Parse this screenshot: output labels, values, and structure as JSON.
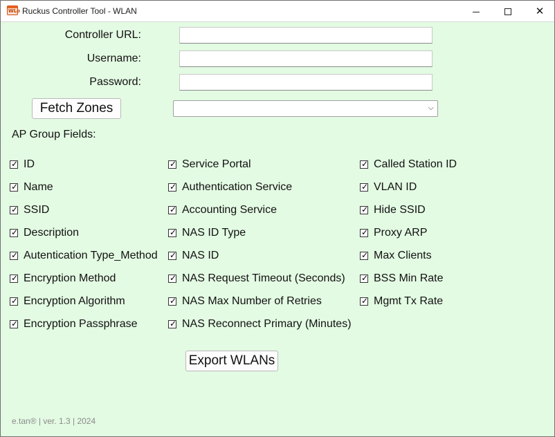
{
  "window": {
    "title": "Ruckus Controller Tool - WLAN",
    "app_icon_glyph": "WLo",
    "minimize_glyph": "",
    "close_glyph": "✕"
  },
  "form": {
    "controller_url_label": "Controller URL:",
    "controller_url_value": "",
    "username_label": "Username:",
    "username_value": "",
    "password_label": "Password:",
    "password_value": "",
    "fetch_zones_label": "Fetch Zones",
    "zone_selected": "",
    "zone_chevron": "⌵"
  },
  "ap_group_fields_label": "AP Group Fields:",
  "checkbox_mark": "✓",
  "fields": {
    "col1": [
      {
        "label": "ID",
        "checked": true
      },
      {
        "label": "Name",
        "checked": true
      },
      {
        "label": "SSID",
        "checked": true
      },
      {
        "label": "Description",
        "checked": true
      },
      {
        "label": "Autentication Type_Method",
        "checked": true
      },
      {
        "label": "Encryption Method",
        "checked": true
      },
      {
        "label": "Encryption Algorithm",
        "checked": true
      },
      {
        "label": "Encryption Passphrase",
        "checked": true
      }
    ],
    "col2": [
      {
        "label": "Service Portal",
        "checked": true
      },
      {
        "label": "Authentication Service",
        "checked": true
      },
      {
        "label": "Accounting Service",
        "checked": true
      },
      {
        "label": "NAS ID Type",
        "checked": true
      },
      {
        "label": "NAS ID",
        "checked": true
      },
      {
        "label": "NAS Request Timeout (Seconds)",
        "checked": true
      },
      {
        "label": "NAS Max Number of Retries",
        "checked": true
      },
      {
        "label": "NAS Reconnect Primary (Minutes)",
        "checked": true
      }
    ],
    "col3": [
      {
        "label": "Called Station ID",
        "checked": true
      },
      {
        "label": "VLAN ID",
        "checked": true
      },
      {
        "label": "Hide SSID",
        "checked": true
      },
      {
        "label": "Proxy ARP",
        "checked": true
      },
      {
        "label": "Max Clients",
        "checked": true
      },
      {
        "label": "BSS Min Rate",
        "checked": true
      },
      {
        "label": "Mgmt Tx Rate",
        "checked": true
      }
    ]
  },
  "export_button_label": "Export WLANs",
  "footer": "e.tan® | ver. 1.3 | 2024",
  "colors": {
    "window_background": "#e3fae3",
    "titlebar_background": "#ffffff",
    "icon_accent": "#e8641f"
  }
}
